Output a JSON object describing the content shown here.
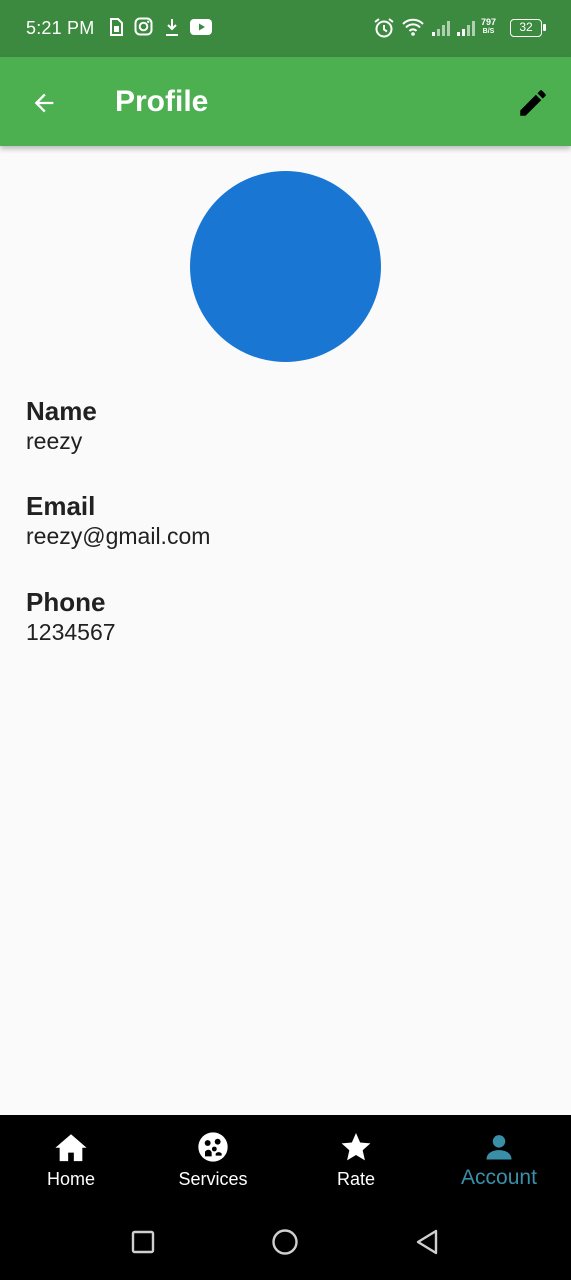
{
  "status_bar": {
    "time": "5:21 PM",
    "battery": "32",
    "net_speed_value": "797",
    "net_speed_unit": "B/S",
    "icons": [
      "sim-card-icon",
      "instagram-icon",
      "download-icon",
      "youtube-icon",
      "alarm-icon",
      "wifi-icon",
      "signal-icon",
      "signal-icon",
      "battery-icon"
    ]
  },
  "app_bar": {
    "title": "Profile",
    "back_icon": "arrow-back-icon",
    "edit_icon": "edit-pencil-icon",
    "background": "#4caf50"
  },
  "profile": {
    "avatar_color": "#1976d2",
    "fields": [
      {
        "label": "Name",
        "value": "reezy"
      },
      {
        "label": "Email",
        "value": "reezy@gmail.com"
      },
      {
        "label": "Phone",
        "value": "1234567"
      }
    ]
  },
  "bottom_nav": {
    "items": [
      {
        "label": "Home",
        "icon": "home-icon"
      },
      {
        "label": "Services",
        "icon": "services-icon"
      },
      {
        "label": "Rate",
        "icon": "star-icon"
      },
      {
        "label": "Account",
        "icon": "person-icon"
      }
    ],
    "active": "Account",
    "active_color": "#3a8fa8"
  },
  "system_nav": {
    "buttons": [
      "recents-square-icon",
      "home-circle-icon",
      "back-triangle-icon"
    ]
  }
}
